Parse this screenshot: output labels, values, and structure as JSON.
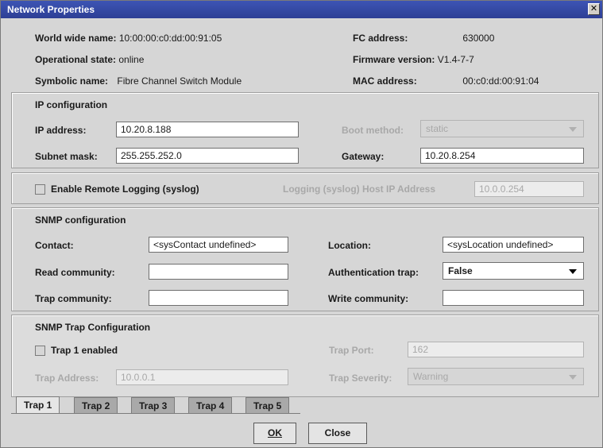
{
  "window": {
    "title": "Network Properties",
    "close_glyph": "✕"
  },
  "info": {
    "wwn_label": "World wide name:",
    "wwn_value": "10:00:00:c0:dd:00:91:05",
    "op_label": "Operational state:",
    "op_value": "online",
    "sym_label": "Symbolic name:",
    "sym_value": "Fibre Channel Switch Module",
    "fc_label": "FC address:",
    "fc_value": "630000",
    "fw_label": "Firmware version:",
    "fw_value": "V1.4-7-7",
    "mac_label": "MAC address:",
    "mac_value": "00:c0:dd:00:91:04"
  },
  "ip": {
    "title": "IP configuration",
    "address_label": "IP address:",
    "address_value": "10.20.8.188",
    "subnet_label": "Subnet mask:",
    "subnet_value": "255.255.252.0",
    "boot_label": "Boot method:",
    "boot_value": "static",
    "gateway_label": "Gateway:",
    "gateway_value": "10.20.8.254"
  },
  "logging": {
    "enable_label": "Enable Remote Logging (syslog)",
    "host_label": "Logging (syslog) Host IP Address",
    "host_value": "10.0.0.254",
    "checked": false
  },
  "snmp": {
    "title": "SNMP configuration",
    "contact_label": "Contact:",
    "contact_value": "<sysContact undefined>",
    "read_label": "Read community:",
    "read_value": "",
    "trap_label": "Trap community:",
    "trap_value": "",
    "location_label": "Location:",
    "location_value": "<sysLocation undefined>",
    "auth_label": "Authentication trap:",
    "auth_value": "False",
    "write_label": "Write community:",
    "write_value": ""
  },
  "trapcfg": {
    "title": "SNMP Trap Configuration",
    "enabled_label": "Trap 1 enabled",
    "enabled": false,
    "port_label": "Trap Port:",
    "port_value": "162",
    "address_label": "Trap Address:",
    "address_value": "10.0.0.1",
    "severity_label": "Trap Severity:",
    "severity_value": "Warning"
  },
  "tabs": [
    "Trap 1",
    "Trap 2",
    "Trap 3",
    "Trap 4",
    "Trap 5"
  ],
  "active_tab": "Trap 1",
  "buttons": {
    "ok": "OK",
    "close": "Close"
  }
}
